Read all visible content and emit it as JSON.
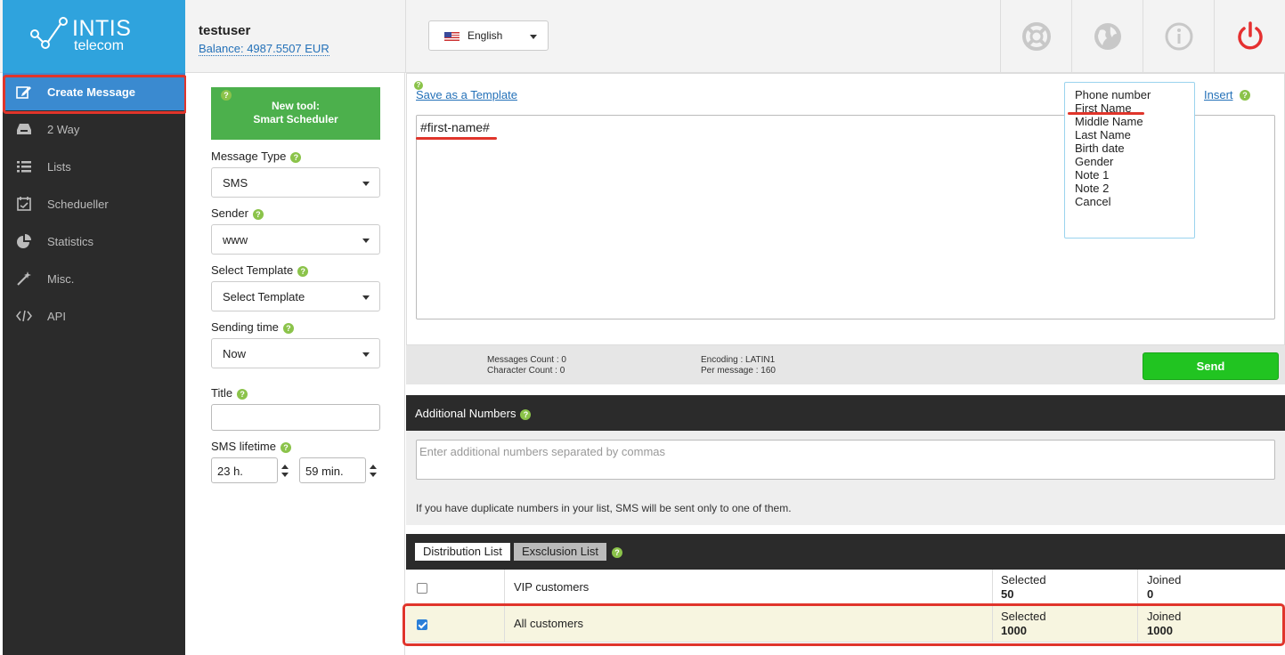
{
  "brand": {
    "name": "INTIS",
    "sub": "telecom"
  },
  "user": {
    "name": "testuser",
    "balance": "Balance: 4987.5507 EUR"
  },
  "language": {
    "selected": "English"
  },
  "sidebar": {
    "items": [
      {
        "label": "Create Message",
        "icon": "edit-icon"
      },
      {
        "label": "2 Way",
        "icon": "inbox-icon"
      },
      {
        "label": "Lists",
        "icon": "list-icon"
      },
      {
        "label": "Schedueller",
        "icon": "calendar-check-icon"
      },
      {
        "label": "Statistics",
        "icon": "pie-chart-icon"
      },
      {
        "label": "Misc.",
        "icon": "magic-wand-icon"
      },
      {
        "label": "API",
        "icon": "code-icon"
      }
    ]
  },
  "promo": {
    "line1": "New tool:",
    "line2": "Smart Scheduler"
  },
  "form": {
    "message_type": {
      "label": "Message Type",
      "value": "SMS"
    },
    "sender": {
      "label": "Sender",
      "value": "www"
    },
    "template": {
      "label": "Select Template",
      "value": "Select Template"
    },
    "sending_time": {
      "label": "Sending time",
      "value": "Now"
    },
    "title": {
      "label": "Title",
      "value": ""
    },
    "sms_lifetime": {
      "label": "SMS lifetime",
      "hours": "23 h.",
      "minutes": "59 min."
    }
  },
  "editor": {
    "save_template": "Save as a Template",
    "insert": "Insert",
    "content": "#first-name#",
    "insert_menu": [
      "Phone number",
      "First Name",
      "Middle Name",
      "Last Name",
      "Birth date",
      "Gender",
      "Note 1",
      "Note 2",
      "Cancel"
    ]
  },
  "stats": {
    "messages_count": "Messages Count : 0",
    "character_count": "Character Count : 0",
    "encoding": "Encoding : LATIN1",
    "per_message": "Per message : 160"
  },
  "send_label": "Send",
  "additional_numbers": {
    "title": "Additional Numbers",
    "placeholder": "Enter additional numbers separated by commas",
    "note": "If you have duplicate numbers in your list, SMS will be sent only to one of them."
  },
  "lists": {
    "tabs": [
      "Distribution List",
      "Exsclusion List"
    ],
    "selected_label": "Selected",
    "joined_label": "Joined",
    "rows": [
      {
        "name": "VIP customers",
        "selected": "50",
        "joined": "0",
        "checked": false
      },
      {
        "name": "All customers",
        "selected": "1000",
        "joined": "1000",
        "checked": true
      }
    ]
  },
  "colors": {
    "accent": "#2fa3dd",
    "sidebar": "#2b2b2b",
    "send": "#21c421",
    "annotation": "#e0352b"
  }
}
